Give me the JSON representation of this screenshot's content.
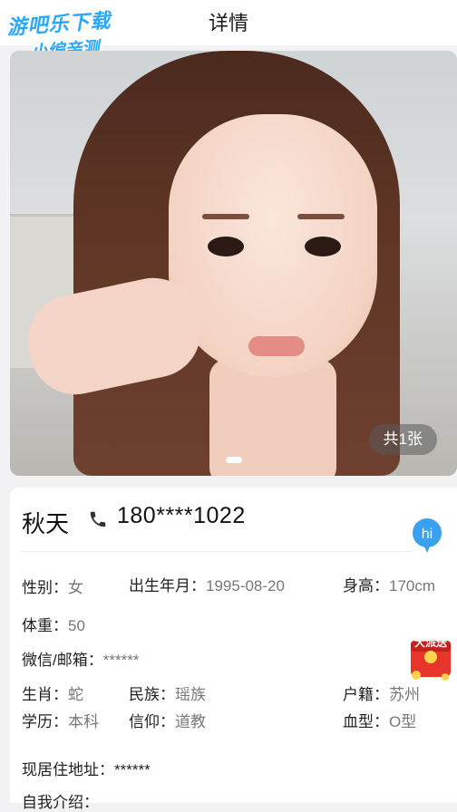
{
  "header": {
    "title": "详情",
    "back_icon": "chevron-left-icon"
  },
  "watermark": {
    "line1": "游吧乐下载",
    "line2": "小编亲测"
  },
  "photo": {
    "count_label": "共1张",
    "page_index": 1,
    "page_total": 1
  },
  "profile": {
    "name": "秋天",
    "phone": "180****1022",
    "gender": {
      "label": "性别：",
      "value": "女"
    },
    "birth": {
      "label": "出生年月：",
      "value": "1995-08-20"
    },
    "height": {
      "label": "身高：",
      "value": "170cm"
    },
    "weight": {
      "label": "体重：",
      "value": "50"
    },
    "wechat": {
      "label": "微信/邮箱：",
      "value": "******"
    },
    "zodiac": {
      "label": "生肖：",
      "value": "蛇"
    },
    "ethnicity": {
      "label": "民族：",
      "value": "瑶族"
    },
    "hukou": {
      "label": "户籍：",
      "value": "苏州"
    },
    "education": {
      "label": "学历：",
      "value": "本科"
    },
    "religion": {
      "label": "信仰：",
      "value": "道教"
    },
    "blood": {
      "label": "血型：",
      "value": "O型"
    },
    "address": {
      "label": "现居住地址：",
      "value": "******"
    },
    "intro": {
      "label": "自我介绍：",
      "value": ""
    }
  },
  "chat_bubble": {
    "text": "hi",
    "color": "#3aa0f0"
  },
  "red_packet": {
    "line1": "红包",
    "line2": "大派送"
  }
}
